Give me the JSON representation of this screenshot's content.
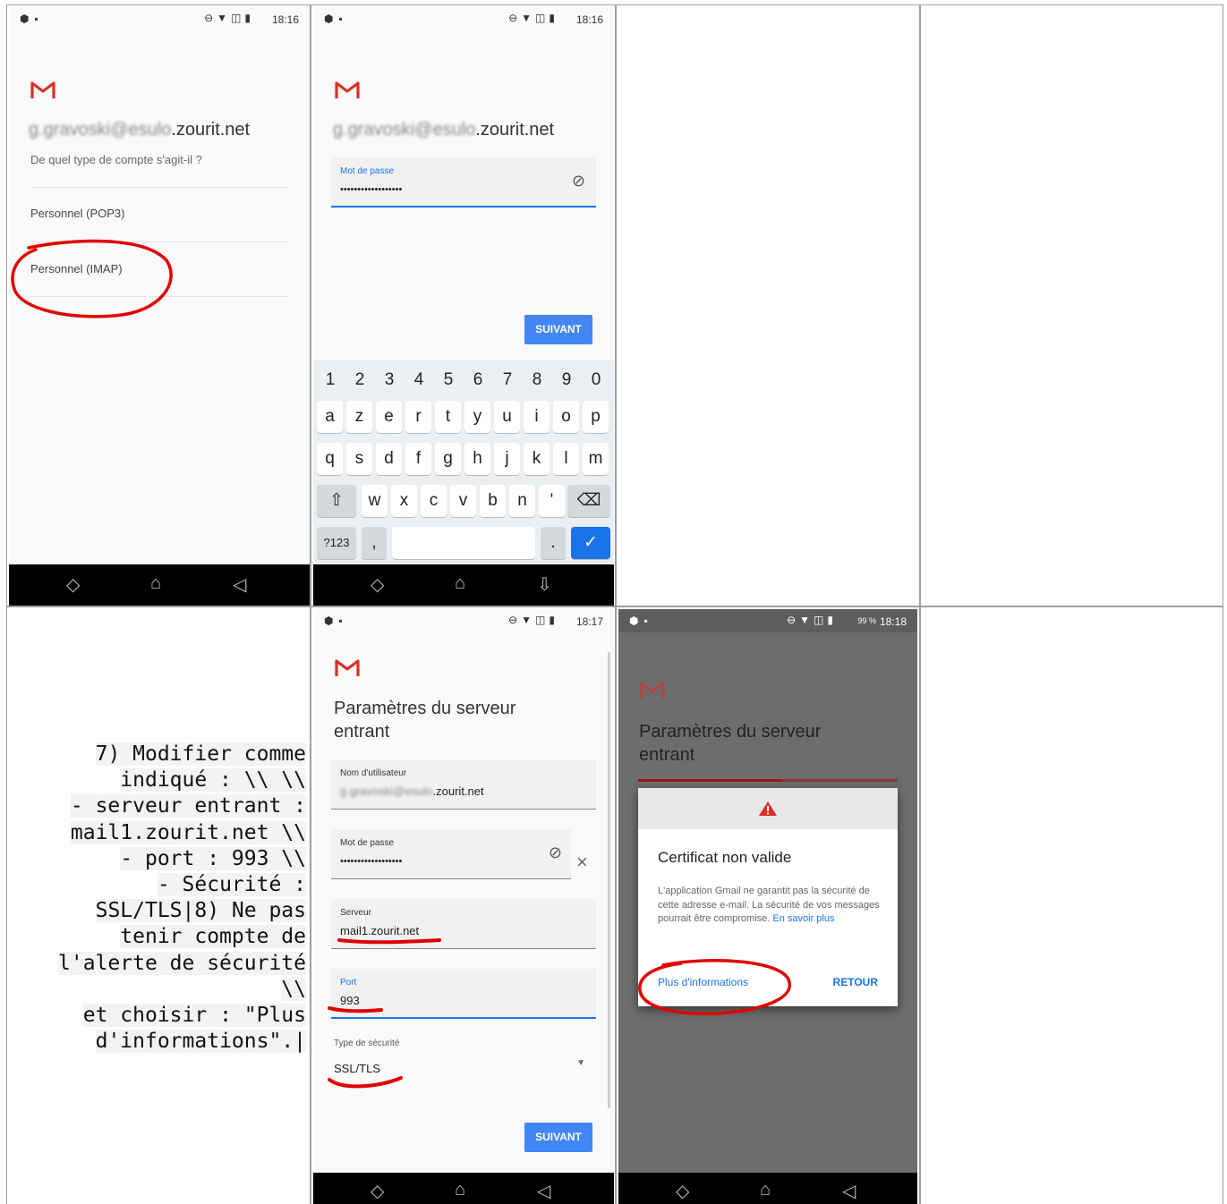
{
  "status": {
    "time_1": "18:16",
    "time_2": "18:16",
    "time_5": "18:17",
    "time_6": "18:18",
    "battery_6": "99 %"
  },
  "screen1": {
    "email_blur": "g.gravoski@esulo",
    "email_domain": ".zourit.net",
    "question": "De quel type de compte s'agit-il ?",
    "option_pop3": "Personnel (POP3)",
    "option_imap": "Personnel (IMAP)"
  },
  "screen2": {
    "email_blur": "g.gravoski@esulo",
    "email_domain": ".zourit.net",
    "password_label": "Mot de passe",
    "password_value": "••••••••••••••••••",
    "next_button": "SUIVANT",
    "keyboard": {
      "numbers": [
        "1",
        "2",
        "3",
        "4",
        "5",
        "6",
        "7",
        "8",
        "9",
        "0"
      ],
      "row1": [
        "a",
        "z",
        "e",
        "r",
        "t",
        "y",
        "u",
        "i",
        "o",
        "p"
      ],
      "row2": [
        "q",
        "s",
        "d",
        "f",
        "g",
        "h",
        "j",
        "k",
        "l",
        "m"
      ],
      "row3": [
        "w",
        "x",
        "c",
        "v",
        "b",
        "n",
        "'"
      ],
      "symbols_key": "?123",
      "comma_key": ",",
      "period_key": "."
    }
  },
  "instructions": {
    "lines": [
      "7) Modifier comme",
      "indiqué : \\\\  \\\\",
      "- serveur entrant :",
      "mail1.zourit.net \\\\",
      "- port : 993 \\\\",
      "- Sécurité :",
      "SSL/TLS|8) Ne pas",
      "tenir compte de",
      "l'alerte de sécurité",
      "\\\\",
      "et choisir : \"Plus",
      "d'informations\".|"
    ]
  },
  "screen5": {
    "title_line1": "Paramètres du serveur",
    "title_line2": "entrant",
    "username_label": "Nom d'utilisateur",
    "username_blur": "g.gravoski@esulo",
    "username_domain": ".zourit.net",
    "password_label": "Mot de passe",
    "password_value": "••••••••••••••••••",
    "server_label": "Serveur",
    "server_value": "mail1.zourit.net",
    "port_label": "Port",
    "port_value": "993",
    "security_label": "Type de sécurité",
    "security_value": "SSL/TLS",
    "next_button": "SUIVANT"
  },
  "screen6": {
    "title_line1": "Paramètres du serveur",
    "title_line2": "entrant",
    "dialog_title": "Certificat non valide",
    "dialog_body": "L'application Gmail ne garantit pas la sécurité de cette adresse e-mail. La sécurité de vos messages pourrait être compromise.",
    "learn_more": "En savoir plus",
    "more_info_button": "Plus d'informations",
    "back_button": "RETOUR"
  },
  "colors": {
    "accent": "#4285f4",
    "gmail_red": "#d93025",
    "annotation_red": "#e00000"
  }
}
